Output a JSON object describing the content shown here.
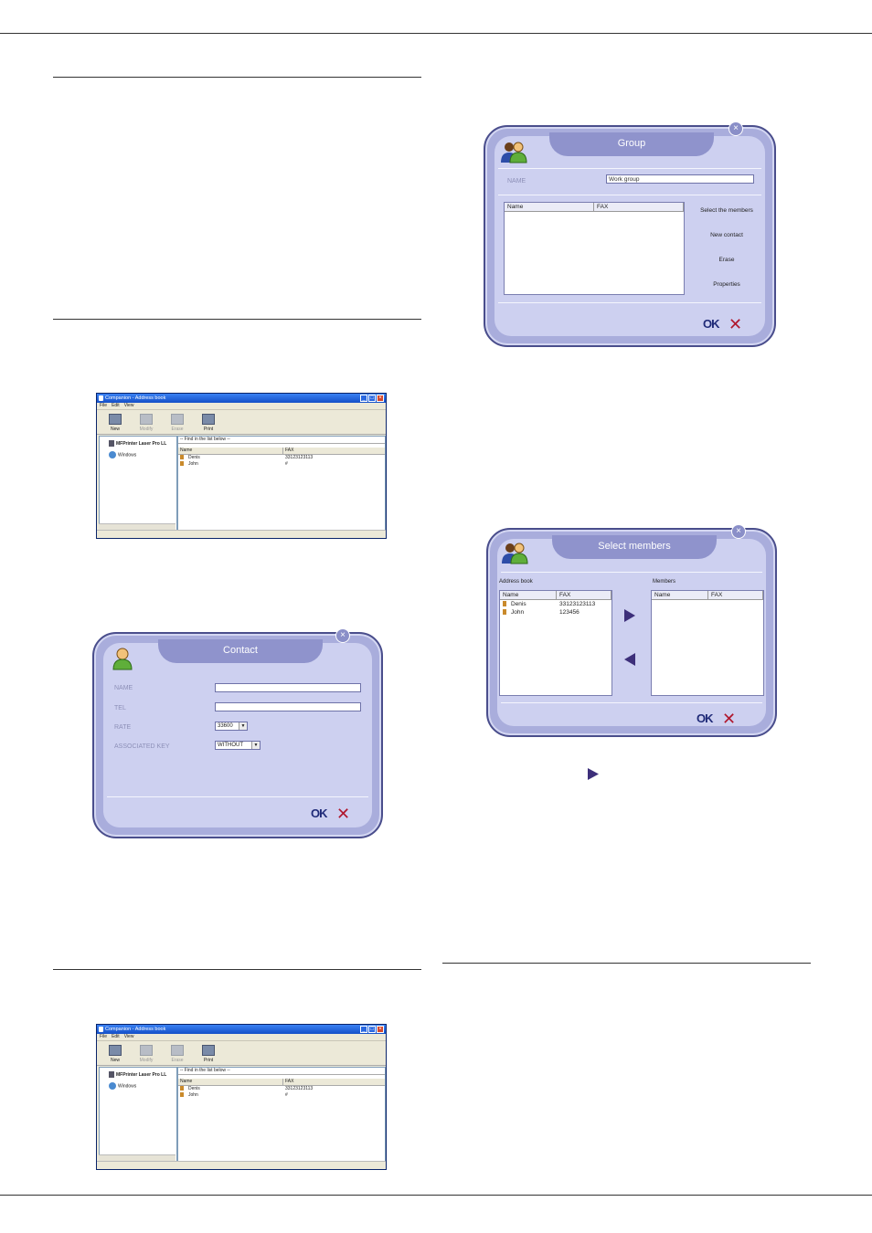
{
  "address_book_window": {
    "title": "Companion - Address book",
    "menu": [
      "File",
      "Edit",
      "View"
    ],
    "toolbar": [
      "New",
      "Modify",
      "Erase",
      "Print"
    ],
    "tree_root": "MFPrinter Laser Pro LL",
    "tree_child": "Windows",
    "find_hint": "-- Find in the list below --",
    "columns": [
      "Name",
      "FAX"
    ],
    "rows": [
      {
        "name": "Denis",
        "fax": "33123123113"
      },
      {
        "name": "John",
        "fax": "#"
      }
    ]
  },
  "contact_dialog": {
    "title": "Contact",
    "name_label": "NAME",
    "tel_label": "TEL",
    "rate_label": "RATE",
    "rate_value": "33600",
    "key_label": "ASSOCIATED KEY",
    "key_value": "WITHOUT",
    "ok_label": "OK",
    "cancel_symbol": "✕"
  },
  "group_dialog": {
    "title": "Group",
    "name_label": "NAME",
    "name_value": "Work group",
    "columns": [
      "Name",
      "FAX"
    ],
    "actions": [
      "Select the members",
      "New contact",
      "Erase",
      "Properties"
    ],
    "ok_label": "OK",
    "cancel_symbol": "✕"
  },
  "select_members_dialog": {
    "title": "Select members",
    "address_book_label": "Address book",
    "members_label": "Members",
    "columns": [
      "Name",
      "FAX"
    ],
    "rows": [
      {
        "name": "Denis",
        "fax": "33123123113"
      },
      {
        "name": "John",
        "fax": "123456"
      }
    ],
    "ok_label": "OK",
    "cancel_symbol": "✕"
  },
  "colors": {
    "dialog_bg": "#a9addc",
    "dialog_inner": "#cdd0f0",
    "ok_blue": "#1f2a78",
    "cancel_red": "#b0172d",
    "arrow_purple": "#3d2f7a"
  }
}
